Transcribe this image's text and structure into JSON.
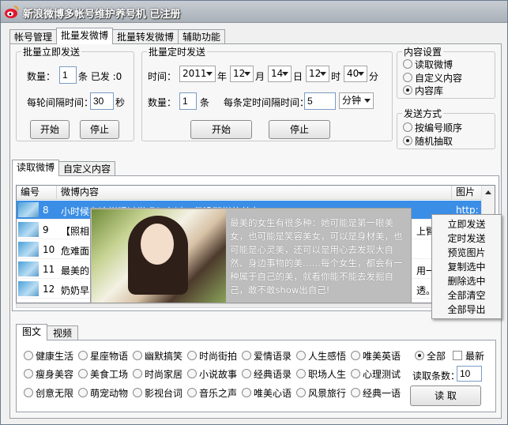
{
  "title": "新浪微博多帐号维护养号机 已注册",
  "main_tabs": [
    "帐号管理",
    "批量发微博",
    "批量转发微博",
    "辅助功能"
  ],
  "instant": {
    "legend": "批量立即发送",
    "qty_label": "数量：",
    "qty_value": "1",
    "sent_label": "条 已发 :0",
    "interval_label": "每轮间隔时间：",
    "interval_value": "30",
    "sec_label": "秒",
    "start": "开始",
    "stop": "停止"
  },
  "scheduled": {
    "legend": "批量定时发送",
    "time_label": "时间：",
    "year": "2011",
    "year_unit": "年",
    "month": "12",
    "month_unit": "月",
    "day": "14",
    "day_unit": "日",
    "hour": "12",
    "hour_unit": "时",
    "minute": "40",
    "minute_unit": "分",
    "qty_label": "数量：",
    "qty_value": "1",
    "qty_unit": "条",
    "interval_label": "每条定时间隔时间：",
    "interval_value": "5",
    "interval_unit": "分钟",
    "start": "开始",
    "stop": "停止"
  },
  "content_settings": {
    "legend": "内容设置",
    "options": [
      "读取微博",
      "自定义内容",
      "内容库"
    ],
    "selected": "内容库"
  },
  "send_method": {
    "legend": "发送方式",
    "options": [
      "按编号顺序",
      "随机抽取"
    ],
    "selected": "随机抽取"
  },
  "content_tabs": [
    "读取微博",
    "自定义内容"
  ],
  "grid": {
    "headers": [
      "编号",
      "微博内容",
      "图片"
    ],
    "rows": [
      {
        "num": "8",
        "text": "小时候在这样睡过觉吗？有过。但没那样的美女那就睡吧",
        "pic": "http:",
        "selected": true
      },
      {
        "num": "9",
        "text": "【照相"
      },
      {
        "num": "10",
        "text": "危难面"
      },
      {
        "num": "11",
        "text": "最美的"
      },
      {
        "num": "12",
        "text": "奶奶早"
      }
    ],
    "right_fragments": [
      "上臂",
      "用一",
      "透。"
    ]
  },
  "popup_text": "最美的女生有很多种：她可能是第一眼美女，也可能是笑容美女，可以是身材美，也可能是心灵美，还可以是用心去发现大自然、身边事物的美……每个女生，都会有一种属于自己的美，就看你能不能去发掘自己，敢不敢show出自己!",
  "context_menu": [
    "立即发送",
    "定时发送",
    "预览图片",
    "复制选中",
    "删除选中",
    "全部清空",
    "全部导出"
  ],
  "bottom_tabs": [
    "图文",
    "视频"
  ],
  "categories": [
    [
      "健康生活",
      "星座物语",
      "幽默搞笑",
      "时尚街拍",
      "爱情语录",
      "人生感悟",
      "唯美英语"
    ],
    [
      "瘦身美容",
      "美食工场",
      "时尚家居",
      "小说故事",
      "经典语录",
      "职场人生",
      "心理测试"
    ],
    [
      "创意无限",
      "萌宠动物",
      "影视台词",
      "音乐之声",
      "唯美心语",
      "风景旅行",
      "经典一语"
    ]
  ],
  "all_label": "全部",
  "newest_label": "最新",
  "read_count_label": "读取条数：",
  "read_count_value": "10",
  "read_button": "读  取",
  "colors": {
    "selection": "#3a8ee6",
    "titlebar": "#a9b0b8"
  },
  "icons": {
    "app": "weibo-logo-icon"
  }
}
